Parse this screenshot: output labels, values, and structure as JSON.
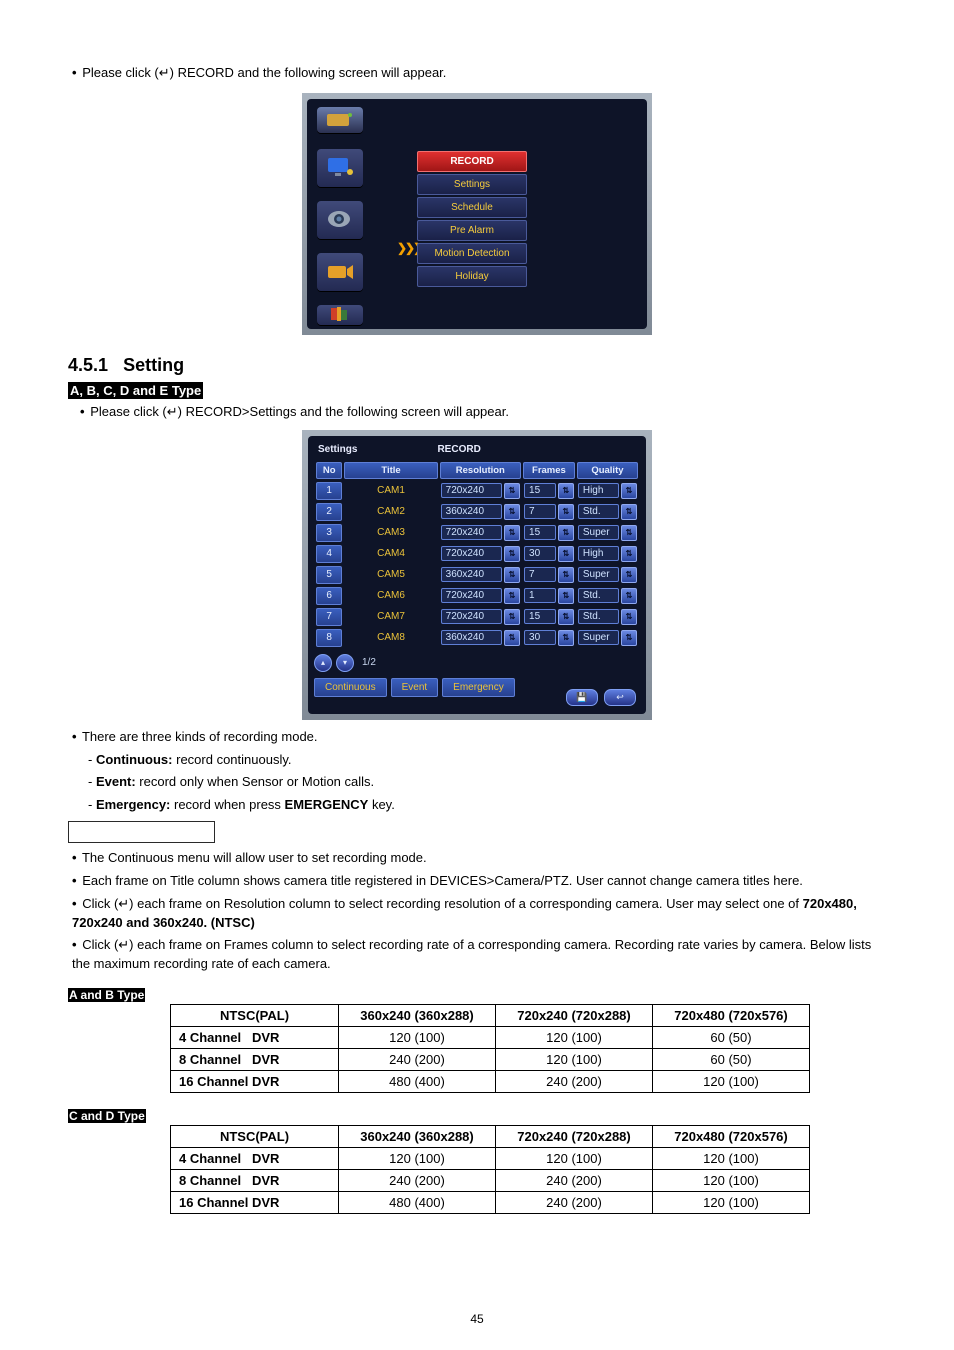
{
  "intro_line": "Please click (↵) RECORD and the following screen will appear.",
  "top_menu": {
    "main": "RECORD",
    "items": [
      "Settings",
      "Schedule",
      "Pre Alarm",
      "Motion Detection",
      "Holiday"
    ],
    "arrow": "❯❯❯"
  },
  "section_number": "4.5.1",
  "section_title": "Setting",
  "type_header1": "A, B, C, D and E Type",
  "settings_click": "Please click (↵) RECORD>Settings and the following screen will appear.",
  "settings_panel": {
    "breadcrumb": [
      "Settings",
      "RECORD"
    ],
    "headers": [
      "No",
      "Title",
      "Resolution",
      "Frames",
      "Quality"
    ],
    "rows": [
      {
        "no": "1",
        "title": "CAM1",
        "res": "720x240",
        "frames": "15",
        "quality": "High"
      },
      {
        "no": "2",
        "title": "CAM2",
        "res": "360x240",
        "frames": "7",
        "quality": "Std."
      },
      {
        "no": "3",
        "title": "CAM3",
        "res": "720x240",
        "frames": "15",
        "quality": "Super"
      },
      {
        "no": "4",
        "title": "CAM4",
        "res": "720x240",
        "frames": "30",
        "quality": "High"
      },
      {
        "no": "5",
        "title": "CAM5",
        "res": "360x240",
        "frames": "7",
        "quality": "Super"
      },
      {
        "no": "6",
        "title": "CAM6",
        "res": "720x240",
        "frames": "1",
        "quality": "Std."
      },
      {
        "no": "7",
        "title": "CAM7",
        "res": "720x240",
        "frames": "15",
        "quality": "Std."
      },
      {
        "no": "8",
        "title": "CAM8",
        "res": "360x240",
        "frames": "30",
        "quality": "Super"
      }
    ],
    "pager": "1/2",
    "tabs": [
      "Continuous",
      "Event",
      "Emergency"
    ]
  },
  "modes_intro": "There are three kinds of recording mode.",
  "modes": [
    {
      "name": "Continuous:",
      "desc": " record continuously."
    },
    {
      "name": "Event:",
      "desc": " record only when Sensor or Motion calls."
    },
    {
      "name": "Emergency:",
      "desc_pre": " record when press ",
      "desc_bold": "EMERGENCY",
      "desc_post": " key."
    }
  ],
  "cont_bullets": [
    "The Continuous menu will allow user to set recording mode.",
    "Each frame on Title column shows camera title registered in DEVICES>Camera/PTZ. User cannot change camera titles here.",
    {
      "pre": "Click (↵) each frame on Resolution column to select recording resolution of a corresponding camera. User may select one of ",
      "bold": "720x480, 720x240 and 360x240. (NTSC)"
    },
    "Click (↵) each frame on Frames column to select recording rate of a corresponding camera. Recording rate varies by camera. Below lists the maximum recording rate of each camera."
  ],
  "type_ab": "A and B Type",
  "type_cd": "C and D Type",
  "rate_headers": [
    "NTSC(PAL)",
    "360x240 (360x288)",
    "720x240 (720x288)",
    "720x480 (720x576)"
  ],
  "rate_ab": [
    [
      "4 Channel   DVR",
      "120 (100)",
      "120 (100)",
      "60 (50)"
    ],
    [
      "8 Channel   DVR",
      "240 (200)",
      "120 (100)",
      "60 (50)"
    ],
    [
      "16 Channel DVR",
      "480 (400)",
      "240 (200)",
      "120 (100)"
    ]
  ],
  "rate_cd": [
    [
      "4 Channel   DVR",
      "120 (100)",
      "120 (100)",
      "120 (100)"
    ],
    [
      "8 Channel   DVR",
      "240 (200)",
      "240 (200)",
      "120 (100)"
    ],
    [
      "16 Channel DVR",
      "480 (400)",
      "240 (200)",
      "120 (100)"
    ]
  ],
  "page_number": "45"
}
